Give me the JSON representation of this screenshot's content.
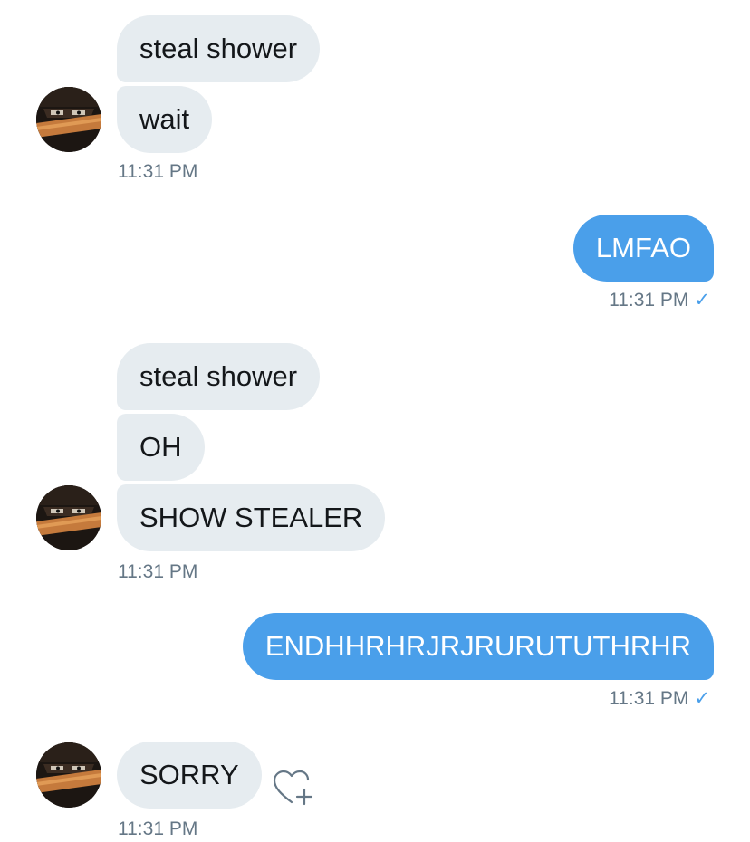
{
  "messages": {
    "m1": "steal shower",
    "m2": "wait",
    "t1": "11:31 PM",
    "m3": "LMFAO",
    "t2": "11:31 PM",
    "m4": "steal shower",
    "m5": "OH",
    "m6": "SHOW STEALER",
    "t3": "11:31 PM",
    "m7": "ENDHHRHRJRJRURUTUTHRHR",
    "t4": "11:31 PM",
    "m8": "SORRY",
    "t5": "11:31 PM"
  },
  "icons": {
    "read_check": "✓",
    "avatar": "profile-avatar",
    "like": "heart-plus-icon"
  },
  "colors": {
    "incoming_bubble": "#e6ecf0",
    "outgoing_bubble": "#4a9fea",
    "timestamp": "#657786",
    "accent": "#4a9fea"
  }
}
